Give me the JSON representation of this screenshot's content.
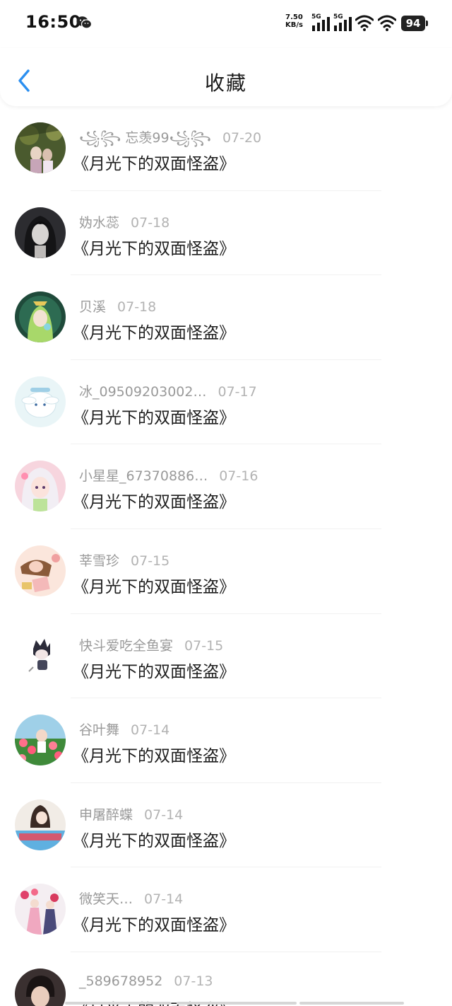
{
  "status_bar": {
    "time": "16:50",
    "net_speed_value": "7.50",
    "net_speed_unit": "KB/s",
    "signal1_label": "5G",
    "signal2_label": "5G",
    "battery": "94",
    "notification_icon": "wechat-icon"
  },
  "header": {
    "title": "收藏",
    "back_icon": "chevron-left-icon",
    "accent_color": "#2b8ff0"
  },
  "favorites": [
    {
      "user": "꧁꧂ 忘羡99꧁꧂",
      "date": "07-20",
      "work": "《月光下的双面怪盗》"
    },
    {
      "user": "妫水蕊",
      "date": "07-18",
      "work": "《月光下的双面怪盗》"
    },
    {
      "user": "贝溪",
      "date": "07-18",
      "work": "《月光下的双面怪盗》"
    },
    {
      "user": "冰_09509203002…",
      "date": "07-17",
      "work": "《月光下的双面怪盗》"
    },
    {
      "user": "小星星_67370886…",
      "date": "07-16",
      "work": "《月光下的双面怪盗》"
    },
    {
      "user": "莘雪珍",
      "date": "07-15",
      "work": "《月光下的双面怪盗》"
    },
    {
      "user": "快斗爱吃全鱼宴",
      "date": "07-15",
      "work": "《月光下的双面怪盗》"
    },
    {
      "user": "谷叶舞",
      "date": "07-14",
      "work": "《月光下的双面怪盗》"
    },
    {
      "user": "申屠醉蝶",
      "date": "07-14",
      "work": "《月光下的双面怪盗》"
    },
    {
      "user": "微笑天…",
      "date": "07-14",
      "work": "《月光下的双面怪盗》"
    },
    {
      "user": "_589678952",
      "date": "07-13",
      "work": "《月光下的双面怪盗》"
    }
  ]
}
